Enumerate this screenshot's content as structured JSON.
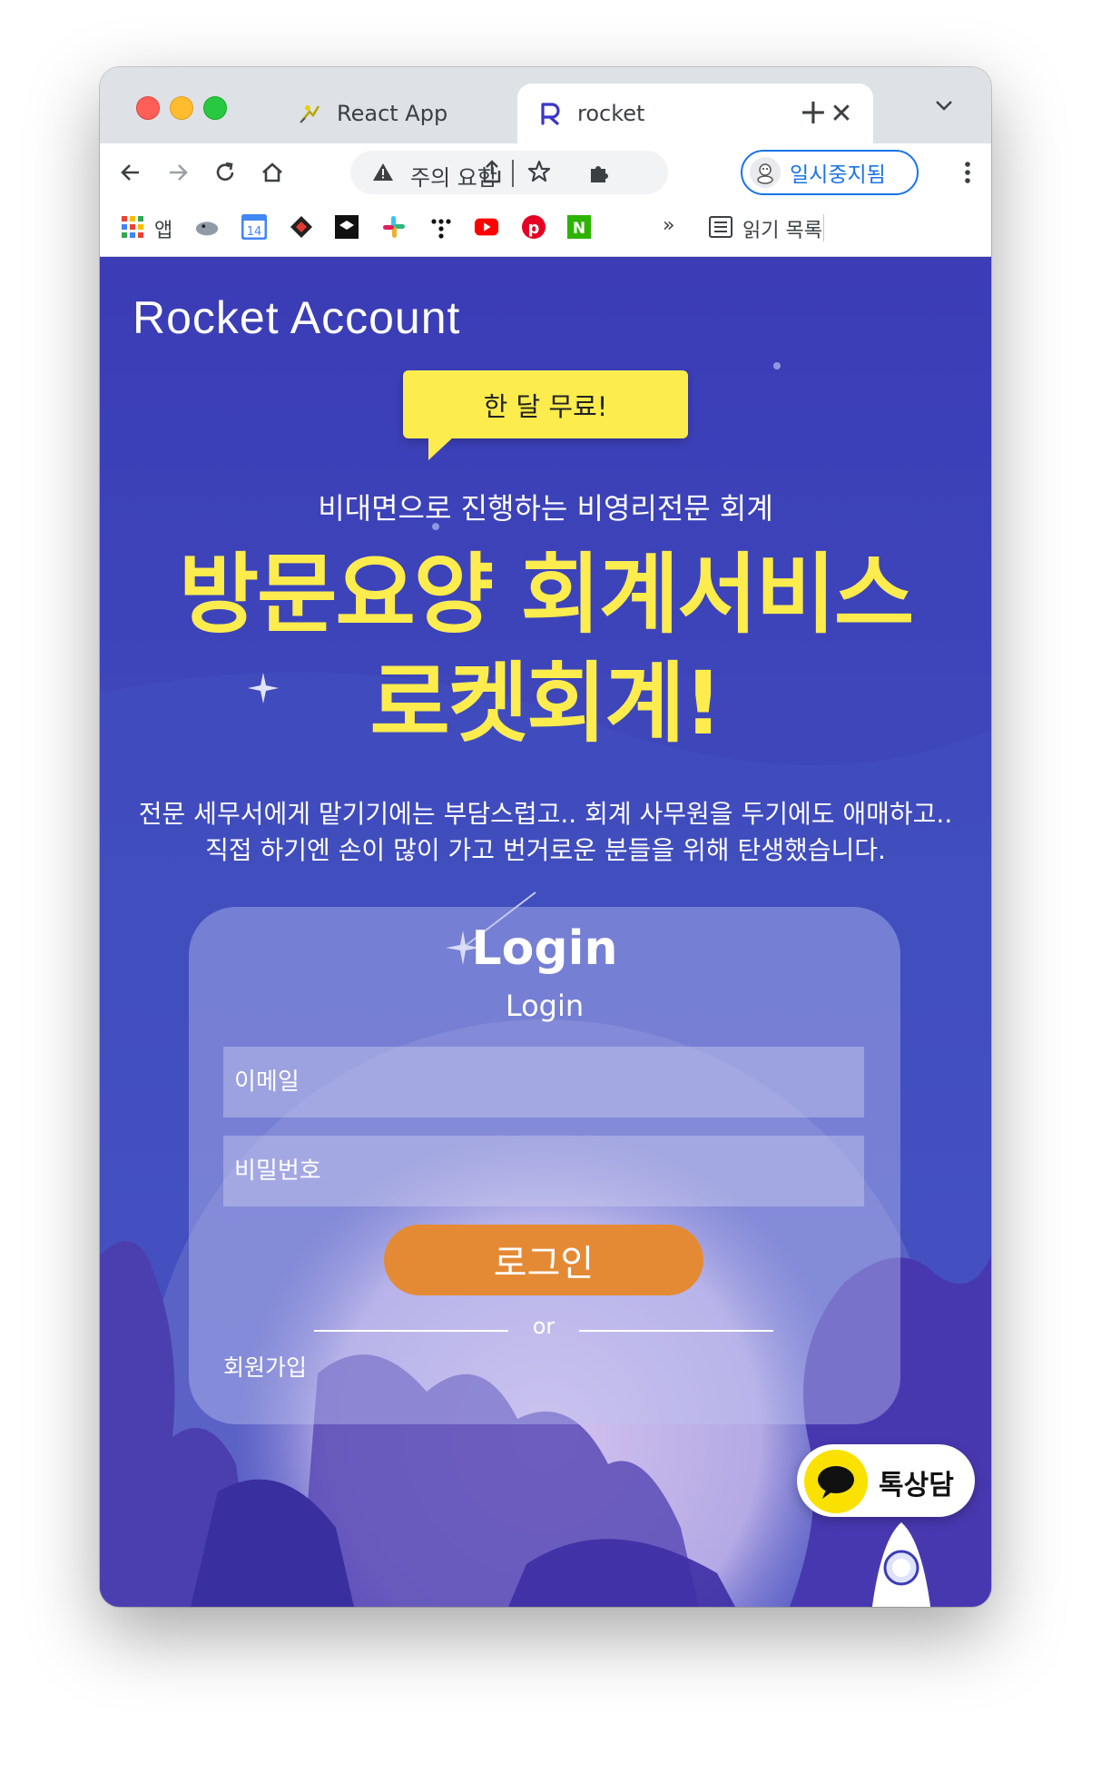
{
  "browser": {
    "tabs": [
      {
        "title": "React App",
        "active": false,
        "icon": "react-app-favicon"
      },
      {
        "title": "rocket",
        "active": true,
        "icon": "rocket-favicon"
      }
    ],
    "omnibox": {
      "security_text": "주의 요함"
    },
    "profile": {
      "label": "일시중지됨"
    },
    "bookmarks": {
      "apps_label": "앱",
      "reading_list_label": "읽기 목록",
      "overflow_label": "»",
      "calendar_day": "14",
      "naver_letter": "N"
    }
  },
  "page": {
    "logo": "Rocket Account",
    "badge": "한 달 무료!",
    "subtitle": "비대면으로 진행하는 비영리전문 회계",
    "headline_line1": "방문요양 회계서비스",
    "headline_line2": "로켓회계!",
    "description": "전문 세무서에게 맡기기에는 부담스럽고.. 회계 사무원을 두기에도 애매하고.. 직접 하기엔 손이 많이 가고 번거로운 분들을 위해 탄생했습니다.",
    "login": {
      "title": "Login",
      "subtitle": "Login",
      "email_placeholder": "이메일",
      "password_placeholder": "비밀번호",
      "submit_label": "로그인",
      "divider_text": "or",
      "signup_label": "회원가입"
    },
    "chat_widget": {
      "label": "톡상담"
    }
  },
  "colors": {
    "page_bg": "#3e3fb8",
    "accent_yellow": "#fcec4e",
    "login_button": "#e48a34",
    "kakao_yellow": "#fae100"
  }
}
